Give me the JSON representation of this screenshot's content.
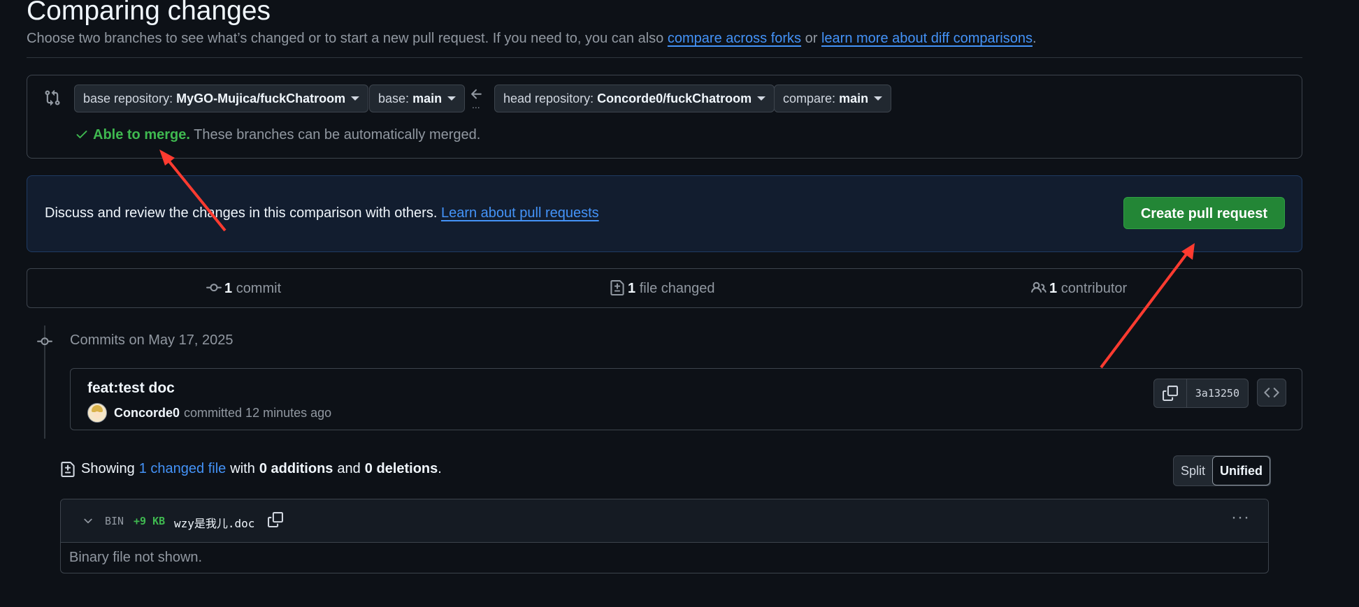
{
  "header": {
    "title": "Comparing changes",
    "subtitle_text": "Choose two branches to see what’s changed or to start a new pull request. If you need to, you can also",
    "link_forks": "compare across forks",
    "or_text": "or",
    "link_diff": "learn more about diff comparisons",
    "period": "."
  },
  "range": {
    "base_repo_label": "base repository:",
    "base_repo_value": "MyGO-Mujica/fuckChatroom",
    "base_label": "base:",
    "base_value": "main",
    "head_repo_label": "head repository:",
    "head_repo_value": "Concorde0/fuckChatroom",
    "compare_label": "compare:",
    "compare_value": "main",
    "dots": "...",
    "merge_ok": "Able to merge.",
    "merge_text": "These branches can be automatically merged."
  },
  "discuss": {
    "text": "Discuss and review the changes in this comparison with others.",
    "link": "Learn about pull requests",
    "button": "Create pull request"
  },
  "stats": {
    "commits_count": "1",
    "commits_label": "commit",
    "files_count": "1",
    "files_label": "file changed",
    "contributors_count": "1",
    "contributors_label": "contributor"
  },
  "timeline": {
    "date_label": "Commits on May 17, 2025"
  },
  "commit": {
    "title": "feat:test doc",
    "author": "Concorde0",
    "meta": "committed 12 minutes ago",
    "sha": "3a13250"
  },
  "summary": {
    "showing": "Showing",
    "changed_link": "1 changed file",
    "with": "with",
    "additions": "0 additions",
    "and": "and",
    "deletions": "0 deletions",
    "end": ".",
    "split": "Split",
    "unified": "Unified"
  },
  "file": {
    "type": "BIN",
    "size": "+9 KB",
    "name": "wzy是我儿.doc",
    "body": "Binary file not shown."
  },
  "colors": {
    "background": "#0d1117",
    "accent_link": "#4493f8",
    "success": "#3fb950",
    "primary_button": "#238636",
    "annotation_arrow": "#ff3b30"
  }
}
